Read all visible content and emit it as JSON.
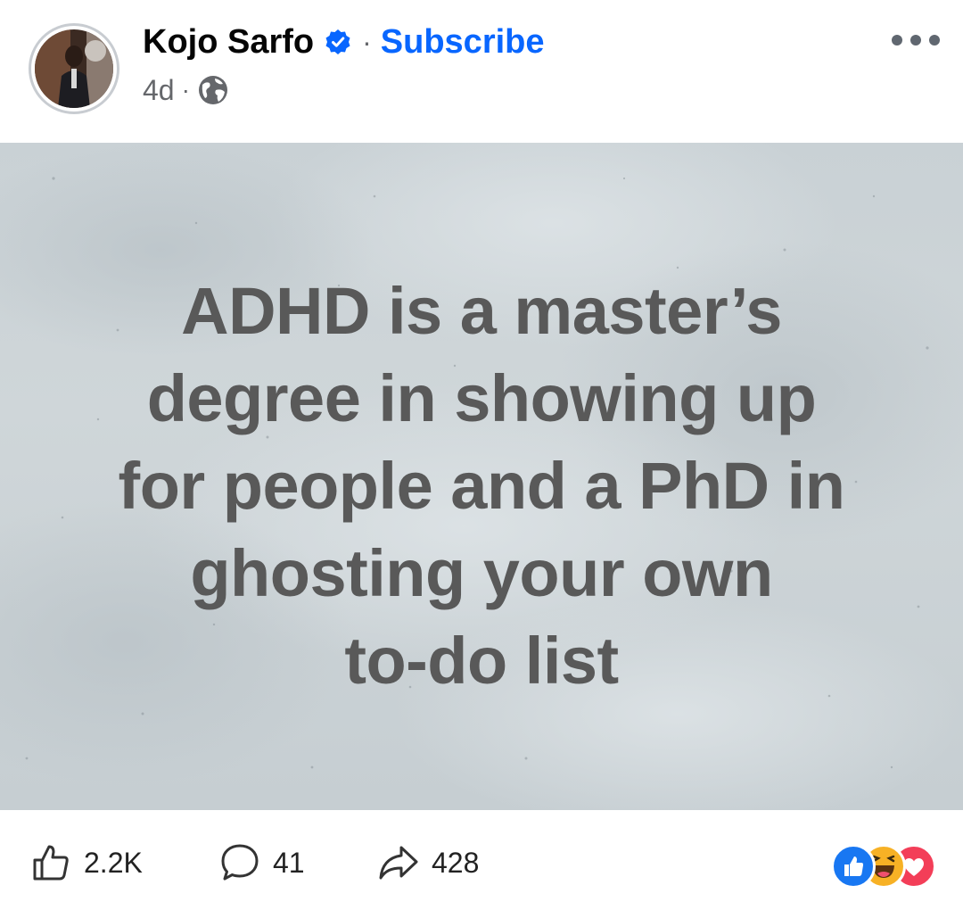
{
  "header": {
    "author_name": "Kojo Sarfo",
    "separator": "·",
    "subscribe_label": "Subscribe",
    "time": "4d",
    "meta_separator": "·",
    "privacy_icon": "globe-icon",
    "verified_icon": "verified-badge-icon",
    "more_icon": "more-options-icon"
  },
  "post_image": {
    "text_lines": [
      "ADHD is a master’s",
      "degree in showing up",
      "for people and a PhD in",
      "ghosting your own",
      "to-do list"
    ]
  },
  "footer": {
    "like_count": "2.2K",
    "comment_count": "41",
    "share_count": "428",
    "reactions": [
      "like-reaction-icon",
      "haha-reaction-icon",
      "love-reaction-icon"
    ]
  },
  "colors": {
    "brand_blue": "#0866ff",
    "name_text": "#050505",
    "meta_text": "#65676b",
    "quote_text": "#595959",
    "image_background": "#cbd3d7"
  }
}
